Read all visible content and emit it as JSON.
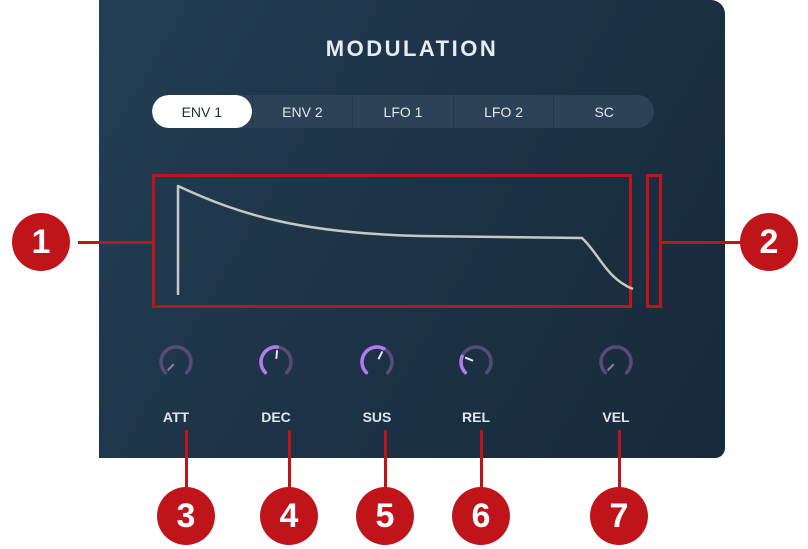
{
  "panel": {
    "title": "MODULATION"
  },
  "tabs": [
    {
      "label": "ENV 1",
      "active": true
    },
    {
      "label": "ENV 2",
      "active": false
    },
    {
      "label": "LFO 1",
      "active": false
    },
    {
      "label": "LFO 2",
      "active": false
    },
    {
      "label": "SC",
      "active": false
    }
  ],
  "knobs": [
    {
      "id": "att",
      "label": "ATT",
      "value": 0.0
    },
    {
      "id": "dec",
      "label": "DEC",
      "value": 0.52
    },
    {
      "id": "sus",
      "label": "SUS",
      "value": 0.6
    },
    {
      "id": "rel",
      "label": "REL",
      "value": 0.25
    },
    {
      "id": "vel",
      "label": "VEL",
      "value": 0.0
    }
  ],
  "callouts": [
    "1",
    "2",
    "3",
    "4",
    "5",
    "6",
    "7"
  ],
  "colors": {
    "panel_bg": "#1d3347",
    "accent_purple": "#b07cf0",
    "knob_track": "#564c74",
    "callout_red": "#c0141b",
    "envelope_line": "#c9c9c4"
  }
}
